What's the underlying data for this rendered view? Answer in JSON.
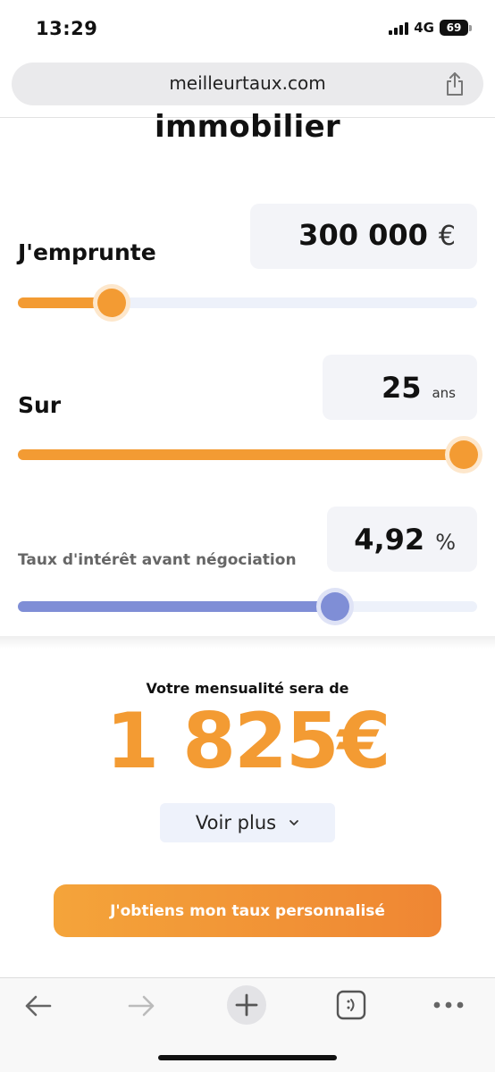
{
  "status_bar": {
    "time": "13:29",
    "network": "4G",
    "battery": "69"
  },
  "browser": {
    "url": "meilleurtaux.com"
  },
  "page": {
    "heading": "immobilier"
  },
  "loan_amount": {
    "label": "J'emprunte",
    "value": "300 000",
    "unit": "€",
    "slider_percent": 20.5
  },
  "duration": {
    "label": "Sur",
    "value": "25",
    "unit": "ans",
    "slider_percent": 97
  },
  "rate": {
    "label": "Taux d'intérêt avant négociation",
    "value": "4,92",
    "unit": "%",
    "slider_percent": 69
  },
  "result": {
    "label": "Votre mensualité sera de",
    "amount": "1 825€"
  },
  "voir_plus": {
    "label": "Voir plus"
  },
  "cta": {
    "label": "J'obtiens mon taux personnalisé"
  },
  "colors": {
    "accent": "#f39b33",
    "rate_slider": "#7f8ed6",
    "track": "#edf1fa",
    "value_box": "#f3f4f8"
  },
  "toolbar": {
    "icons": [
      "back-arrow-icon",
      "forward-arrow-icon",
      "new-tab-plus-icon",
      "tabs-icon",
      "more-icon"
    ]
  }
}
